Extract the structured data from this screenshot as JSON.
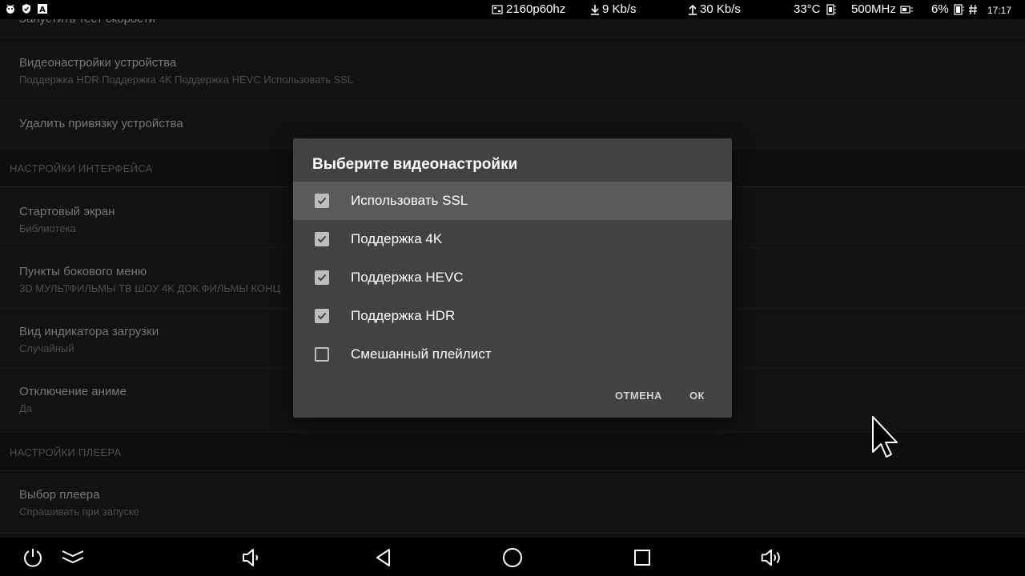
{
  "status_bar": {
    "resolution": "2160p60hz",
    "download": "9 Kb/s",
    "upload": "30 Kb/s",
    "temperature": "33°C",
    "cpu_freq": "500MHz",
    "cpu_load": "6%",
    "time": "17:17",
    "left_icons": [
      "android-debug-icon",
      "shield-check-icon",
      "a-letter-icon"
    ]
  },
  "settings": {
    "partial_top": "Запустить тест скорости",
    "video_settings": {
      "title": "Видеонастройки устройства",
      "sub": "Поддержка HDR Поддержка 4K Поддержка HEVC Использовать SSL"
    },
    "unlink": {
      "title": "Удалить привязку устройства"
    },
    "section_interface": "НАСТРОЙКИ ИНТЕРФЕЙСА",
    "start_screen": {
      "title": "Стартовый экран",
      "sub": "Библиотека"
    },
    "side_menu": {
      "title": "Пункты бокового меню",
      "sub": "3D МУЛЬТФИЛЬМЫ ТВ ШОУ 4K ДОК.ФИЛЬМЫ КОНЦ"
    },
    "loader": {
      "title": "Вид индикатора загрузки",
      "sub": "Случайный"
    },
    "anime": {
      "title": "Отключение аниме",
      "sub": "Да"
    },
    "section_player": "НАСТРОЙКИ ПЛЕЕРА",
    "player": {
      "title": "Выбор плеера",
      "sub": "Спрашивать при запуске"
    }
  },
  "dialog": {
    "title": "Выберите видеонастройки",
    "options": [
      {
        "label": "Использовать SSL",
        "checked": true
      },
      {
        "label": "Поддержка 4K",
        "checked": true
      },
      {
        "label": "Поддержка HEVC",
        "checked": true
      },
      {
        "label": "Поддержка HDR",
        "checked": true
      },
      {
        "label": "Смешанный плейлист",
        "checked": false
      }
    ],
    "cancel_label": "ОТМЕНА",
    "ok_label": "ОК"
  },
  "navbar": {
    "icons": [
      "power-icon",
      "chevron-double-down-icon",
      "volume-down-icon",
      "back-icon",
      "home-icon",
      "recents-icon",
      "volume-up-icon"
    ]
  }
}
